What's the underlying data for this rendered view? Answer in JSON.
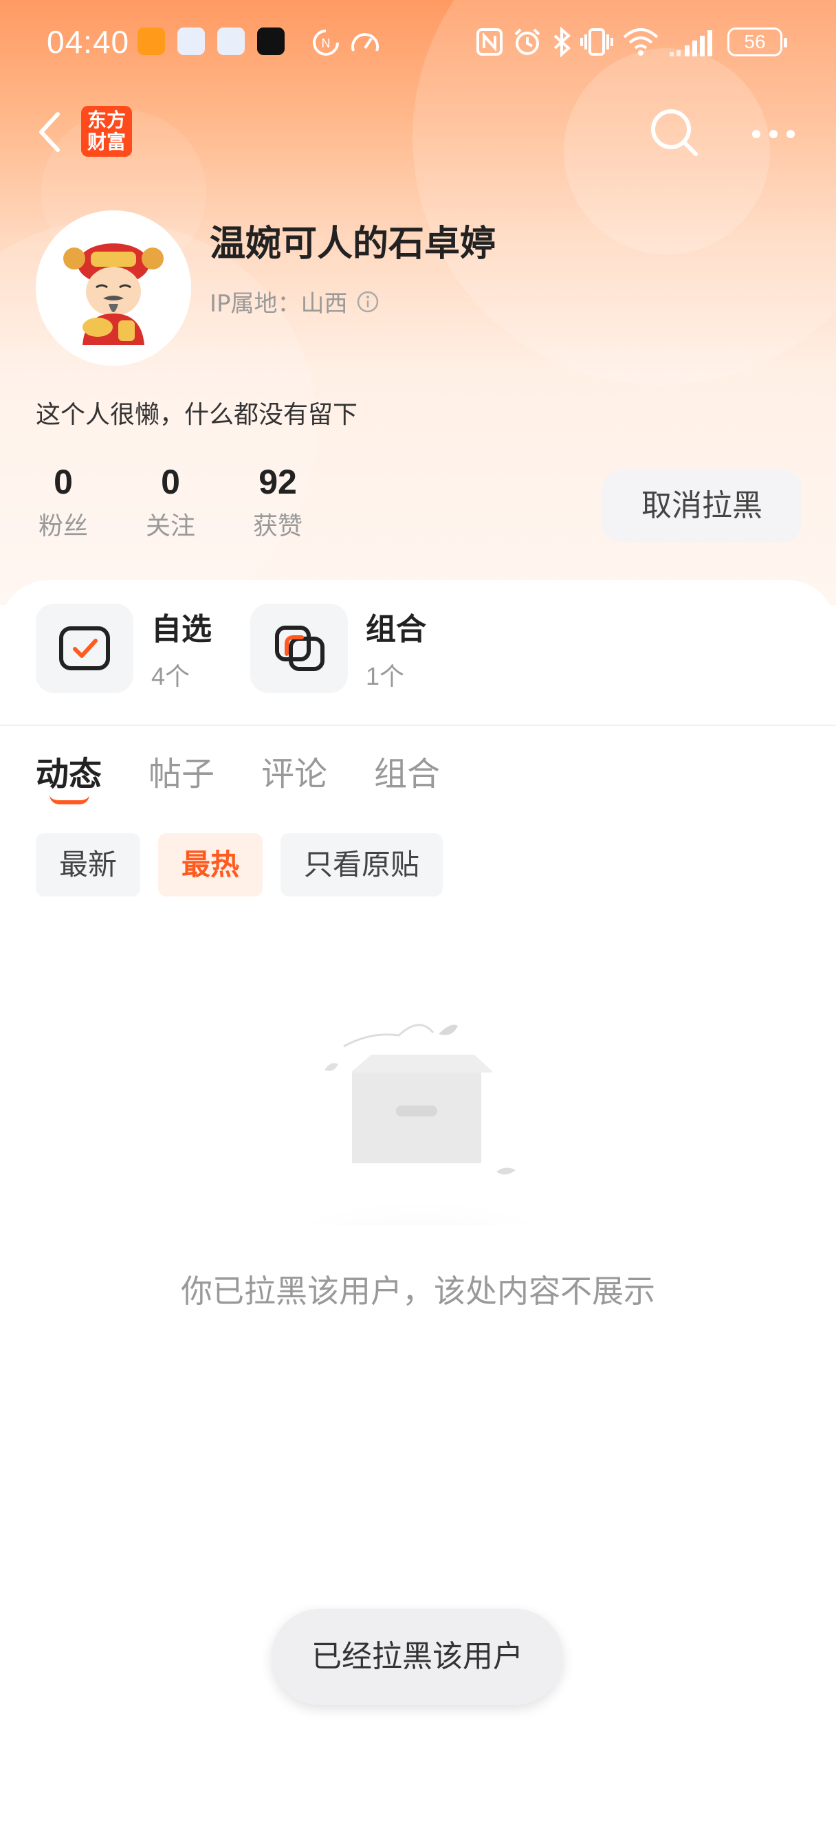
{
  "status_bar": {
    "time": "04:40",
    "battery": "56",
    "icons": [
      "nfc-icon",
      "alarm-icon",
      "bluetooth-icon",
      "vibrate-icon",
      "wifi-icon",
      "signal-icon"
    ]
  },
  "nav": {
    "back_icon": "chevron-left-icon",
    "app_logo_text_line1": "东方",
    "app_logo_text_line2": "财富",
    "search_icon": "search-icon",
    "more_icon": "more-dots-icon"
  },
  "profile": {
    "username": "温婉可人的石卓婷",
    "ip_location": "IP属地：山西",
    "bio": "这个人很懒，什么都没有留下",
    "stats": [
      {
        "value": "0",
        "label": "粉丝"
      },
      {
        "value": "0",
        "label": "关注"
      },
      {
        "value": "92",
        "label": "获赞"
      }
    ],
    "unblock_label": "取消拉黑"
  },
  "features": [
    {
      "title": "自选",
      "count": "4个"
    },
    {
      "title": "组合",
      "count": "1个"
    }
  ],
  "tabs": [
    {
      "label": "动态",
      "active": true
    },
    {
      "label": "帖子",
      "active": false
    },
    {
      "label": "评论",
      "active": false
    },
    {
      "label": "组合",
      "active": false
    }
  ],
  "filters": [
    {
      "label": "最新",
      "active": false
    },
    {
      "label": "最热",
      "active": true
    },
    {
      "label": "只看原贴",
      "active": false
    }
  ],
  "empty_message": "你已拉黑该用户，该处内容不展示",
  "toast": "已经拉黑该用户",
  "colors": {
    "accent": "#ff5a1f",
    "header_gradient_top": "#ff9a62",
    "logo_bg": "#ff4a1c"
  }
}
